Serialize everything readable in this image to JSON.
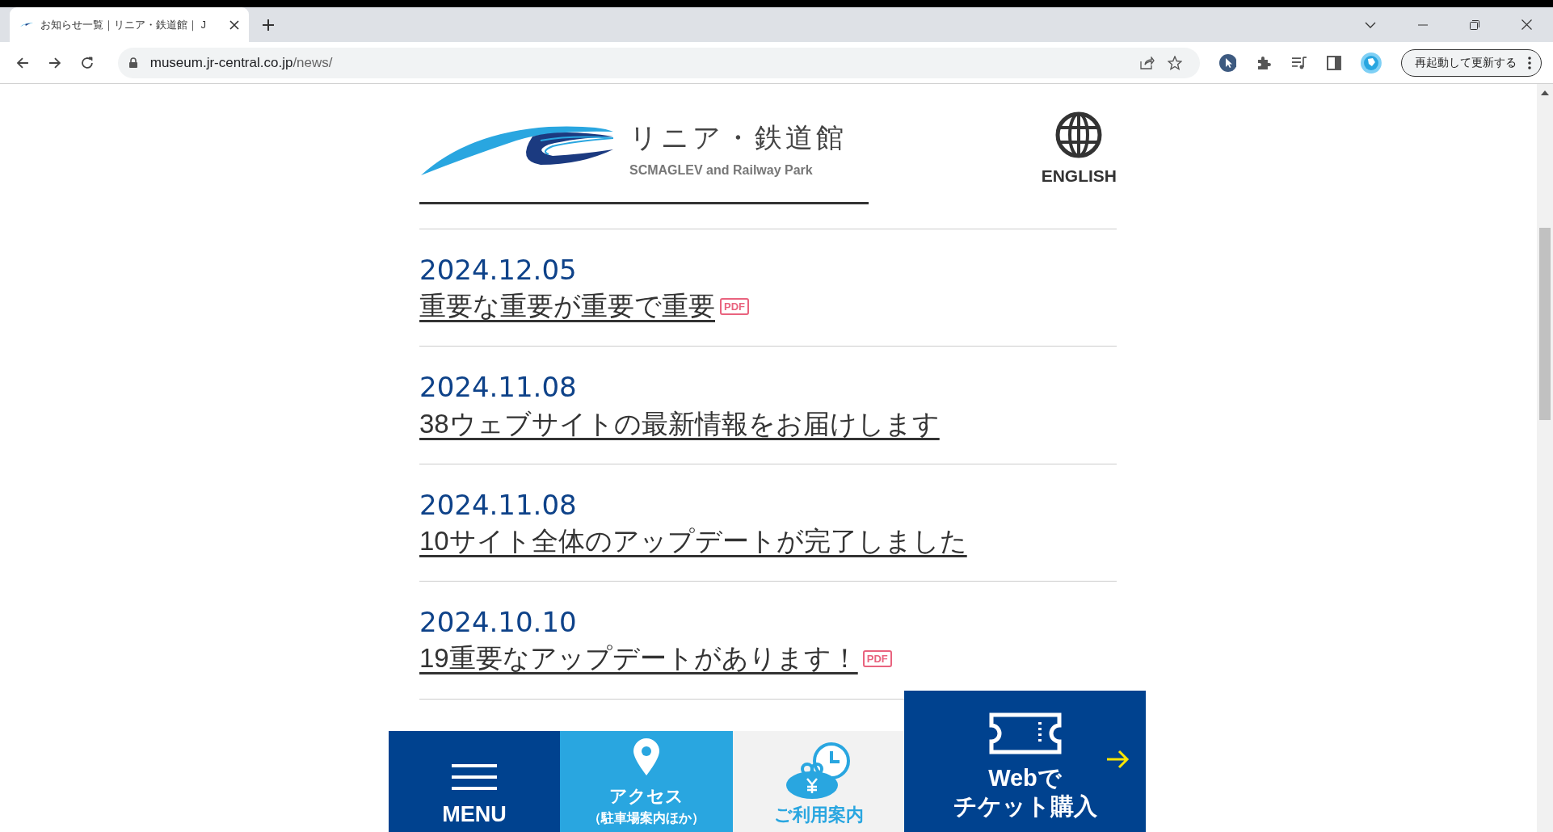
{
  "browser": {
    "tab": {
      "title": "お知らせ一覧｜リニア・鉄道館｜ J",
      "selected": true
    },
    "address": {
      "host": "museum.jr-central.co.jp",
      "path": "/news/"
    },
    "update_button": "再起動して更新する"
  },
  "header": {
    "logo_title": "リニア・鉄道館",
    "logo_subtitle": "SCMAGLEV and Railway Park",
    "language": "ENGLISH"
  },
  "news": [
    {
      "date": "2024.12.05",
      "title": "重要な重要が重要で重要",
      "badge": "PDF"
    },
    {
      "date": "2024.11.08",
      "title": "38ウェブサイトの最新情報をお届けします"
    },
    {
      "date": "2024.11.08",
      "title": "10サイト全体のアップデートが完了しました"
    },
    {
      "date": "2024.10.10",
      "title": "19重要なアップデートがあります！",
      "badge": "PDF"
    }
  ],
  "bottom_nav": [
    {
      "kind": "menu",
      "label": "MENU"
    },
    {
      "kind": "access",
      "label": "アクセス",
      "sublabel": "（駐車場案内ほか）"
    },
    {
      "kind": "guide",
      "label": "ご利用案内"
    },
    {
      "kind": "ticket",
      "lines": [
        "Webで",
        "チケット購入"
      ]
    }
  ]
}
